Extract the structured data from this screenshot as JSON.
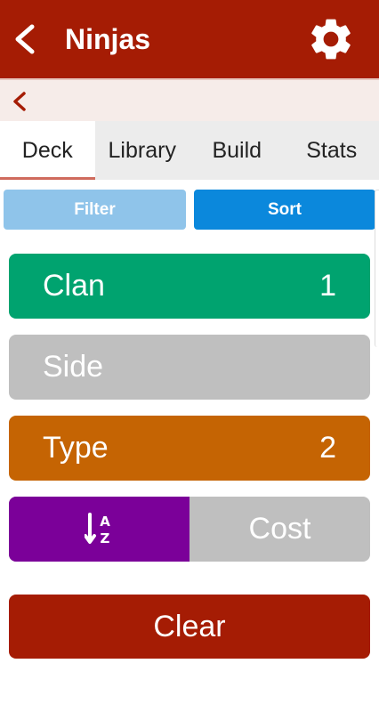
{
  "appbar": {
    "title": "Ninjas",
    "back_icon": "arrow-back-icon",
    "settings_icon": "gear-icon",
    "color": "#a51c04"
  },
  "subbar": {
    "chevron_icon": "chevron-left-icon"
  },
  "tabs": [
    {
      "label": "Deck",
      "active": true
    },
    {
      "label": "Library",
      "active": false
    },
    {
      "label": "Build",
      "active": false
    },
    {
      "label": "Stats",
      "active": false
    }
  ],
  "toolbar": {
    "filter_label": "Filter",
    "sort_label": "Sort",
    "active": "Sort"
  },
  "sort_options": [
    {
      "label": "Clan",
      "count": "1",
      "color": "#00a36f"
    },
    {
      "label": "Side",
      "count": "",
      "color": "#bfbfbf"
    },
    {
      "label": "Type",
      "count": "2",
      "color": "#c56403"
    }
  ],
  "cost_row": {
    "sort_icon": "sort-alpha-icon",
    "label": "Cost",
    "toggle_color": "#7b0099"
  },
  "clear_label": "Clear"
}
